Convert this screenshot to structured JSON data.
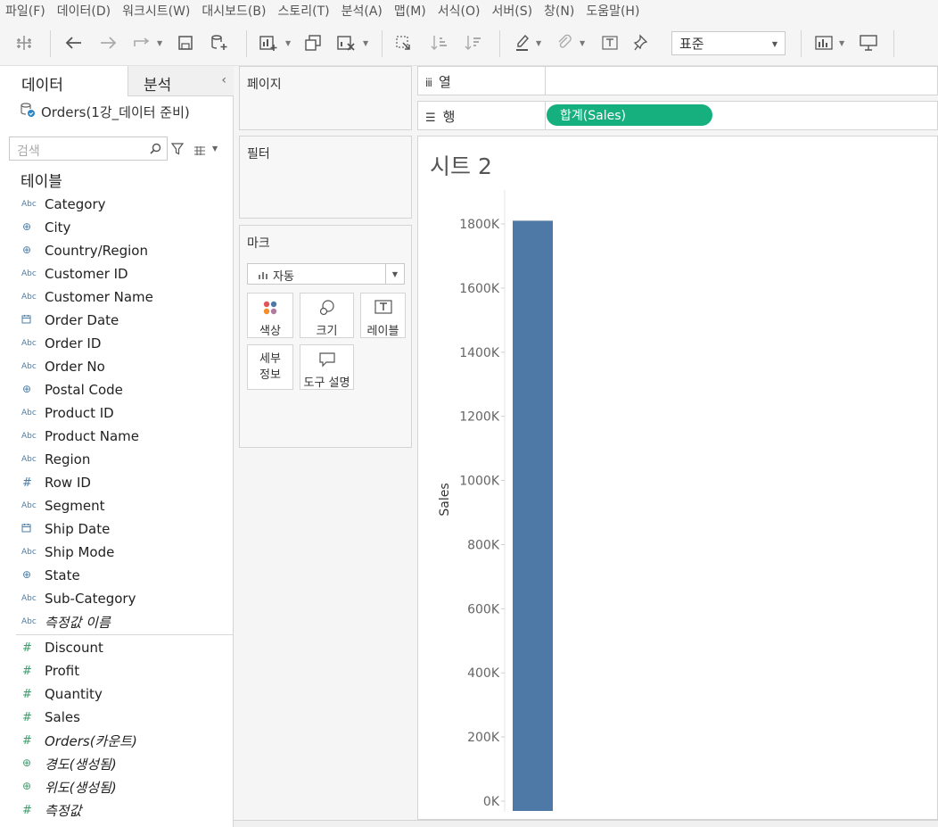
{
  "menu": [
    "파일(F)",
    "데이터(D)",
    "워크시트(W)",
    "대시보드(B)",
    "스토리(T)",
    "분석(A)",
    "맵(M)",
    "서식(O)",
    "서버(S)",
    "창(N)",
    "도움말(H)"
  ],
  "toolbar": {
    "fit_value": "표준",
    "icons": [
      "tableau-logo-icon",
      "undo-icon",
      "redo-icon",
      "replay-icon",
      "save-icon",
      "new-datasource-icon",
      "new-worksheet-icon",
      "duplicate-icon",
      "clear-sheet-icon",
      "swap-icon",
      "sort-ascending-icon",
      "sort-descending-icon",
      "highlight-icon",
      "group-icon",
      "label-icon",
      "pin-icon",
      "show-me-icon",
      "presentation-icon"
    ]
  },
  "datapane": {
    "tab_data": "데이터",
    "tab_analysis": "분석",
    "datasource": "Orders(1강_데이터 준비)",
    "search_placeholder": "검색",
    "tables_heading": "테이블",
    "dimensions": [
      {
        "type": "Abc",
        "name": "Category"
      },
      {
        "type": "globe",
        "name": "City"
      },
      {
        "type": "globe",
        "name": "Country/Region"
      },
      {
        "type": "Abc",
        "name": "Customer ID"
      },
      {
        "type": "Abc",
        "name": "Customer Name"
      },
      {
        "type": "date",
        "name": "Order Date"
      },
      {
        "type": "Abc",
        "name": "Order ID"
      },
      {
        "type": "Abc",
        "name": "Order No"
      },
      {
        "type": "globe",
        "name": "Postal Code"
      },
      {
        "type": "Abc",
        "name": "Product ID"
      },
      {
        "type": "Abc",
        "name": "Product Name"
      },
      {
        "type": "Abc",
        "name": "Region"
      },
      {
        "type": "hash-blue",
        "name": "Row ID"
      },
      {
        "type": "Abc",
        "name": "Segment"
      },
      {
        "type": "date",
        "name": "Ship Date"
      },
      {
        "type": "Abc",
        "name": "Ship Mode"
      },
      {
        "type": "globe",
        "name": "State"
      },
      {
        "type": "Abc",
        "name": "Sub-Category"
      },
      {
        "type": "Abc",
        "name": "측정값 이름",
        "italic": true
      }
    ],
    "measures": [
      {
        "type": "hash",
        "name": "Discount"
      },
      {
        "type": "hash",
        "name": "Profit"
      },
      {
        "type": "hash",
        "name": "Quantity"
      },
      {
        "type": "hash",
        "name": "Sales"
      },
      {
        "type": "hash",
        "name": "Orders(카운트)",
        "italic": true
      },
      {
        "type": "globe-green",
        "name": "경도(생성됨)",
        "italic": true
      },
      {
        "type": "globe-green",
        "name": "위도(생성됨)",
        "italic": true
      },
      {
        "type": "hash",
        "name": "측정값",
        "italic": true
      }
    ]
  },
  "cards": {
    "pages_title": "페이지",
    "filters_title": "필터",
    "marks_title": "마크",
    "mark_type": "자동",
    "buttons": {
      "color": "색상",
      "size": "크기",
      "label": "레이블",
      "detail": "세부\n정보",
      "tooltip": "도구 설명"
    }
  },
  "shelves": {
    "columns_label": "열",
    "rows_label": "행",
    "rows_pill": "합계(Sales)"
  },
  "sheet": {
    "title": "시트 2"
  },
  "chart_data": {
    "type": "bar",
    "title": "시트 2",
    "ylabel": "Sales",
    "xlabel": "",
    "categories": [
      ""
    ],
    "values": [
      1810000
    ],
    "ylim": [
      0,
      1800000
    ],
    "yticks": [
      0,
      200000,
      400000,
      600000,
      800000,
      1000000,
      1200000,
      1400000,
      1600000,
      1800000
    ],
    "ytick_labels": [
      "0K",
      "200K",
      "400K",
      "600K",
      "800K",
      "1000K",
      "1200K",
      "1400K",
      "1600K",
      "1800K"
    ],
    "color": "#4e79a7",
    "grid": false
  }
}
